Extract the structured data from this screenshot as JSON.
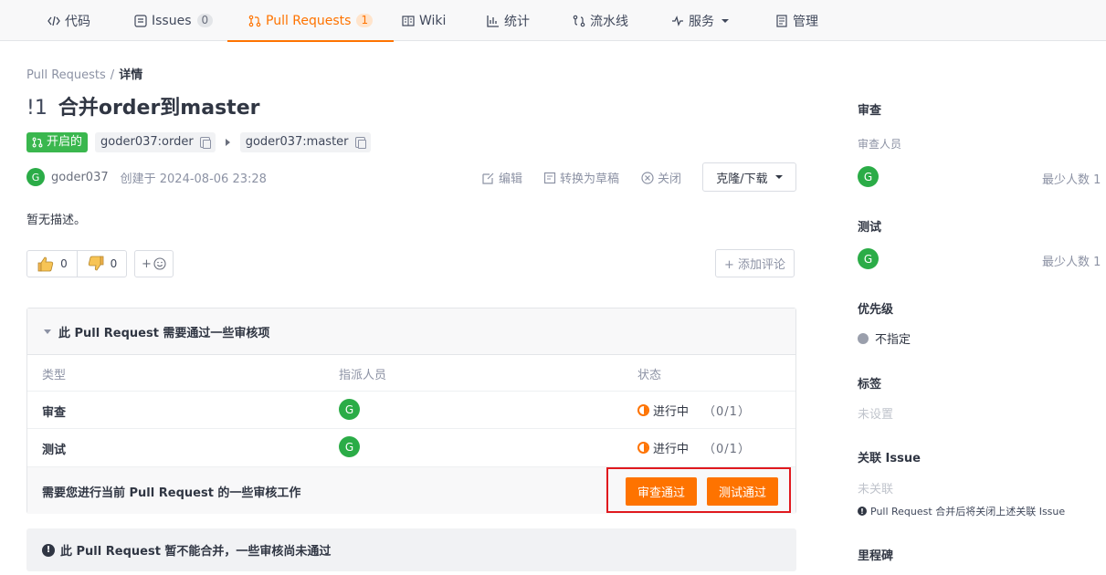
{
  "nav": {
    "tabs": [
      {
        "label": "代码",
        "icon": "code-icon"
      },
      {
        "label": "Issues",
        "icon": "issues-icon",
        "count": "0"
      },
      {
        "label": "Pull Requests",
        "icon": "pull-request-icon",
        "count": "1"
      },
      {
        "label": "Wiki",
        "icon": "wiki-icon"
      },
      {
        "label": "统计",
        "icon": "stats-icon"
      },
      {
        "label": "流水线",
        "icon": "pipeline-icon"
      },
      {
        "label": "服务",
        "icon": "service-icon"
      },
      {
        "label": "管理",
        "icon": "manage-icon"
      }
    ],
    "active_tab": "Pull Requests",
    "accent_color": "#fe7300"
  },
  "breadcrumb": {
    "parent": "Pull Requests",
    "separator": "/",
    "current": "详情"
  },
  "pr": {
    "number": "!1",
    "title": "合并order到master",
    "state": "开启的",
    "source_branch": "goder037:order",
    "target_branch": "goder037:master",
    "author_initial": "G",
    "author": "goder037",
    "created": "创建于 2024-08-06 23:28",
    "description": "暂无描述。"
  },
  "actions": {
    "edit": "编辑",
    "convert_draft": "转换为草稿",
    "close": "关闭",
    "clone": "克隆/下载"
  },
  "reactions": {
    "thumbs_up": "0",
    "thumbs_down": "0",
    "emoji_plus": "+",
    "add_comment": "+ 添加评论"
  },
  "review": {
    "header": "此 Pull Request 需要通过一些审核项",
    "columns": [
      "类型",
      "指派人员",
      "状态"
    ],
    "rows": [
      {
        "type": "审查",
        "assignee": "G",
        "status": "进行中",
        "progress": "（0/1）"
      },
      {
        "type": "测试",
        "assignee": "G",
        "status": "进行中",
        "progress": "（0/1）"
      }
    ],
    "work_label": "需要您进行当前 Pull Request 的一些审核工作",
    "approve_review": "审查通过",
    "approve_test": "测试通过"
  },
  "notice": "此 Pull Request 暂不能合并，一些审核尚未通过",
  "sidebar": {
    "review_title": "审查",
    "reviewer_label": "审查人员",
    "reviewer_initial": "G",
    "review_min": "最少人数 1",
    "test_title": "测试",
    "tester_initial": "G",
    "test_min": "最少人数 1",
    "priority_title": "优先级",
    "priority_value": "不指定",
    "label_title": "标签",
    "label_value": "未设置",
    "issue_title": "关联 Issue",
    "issue_value": "未关联",
    "issue_note": "Pull Request 合并后将关闭上述关联 Issue",
    "milestone_title": "里程碑"
  }
}
